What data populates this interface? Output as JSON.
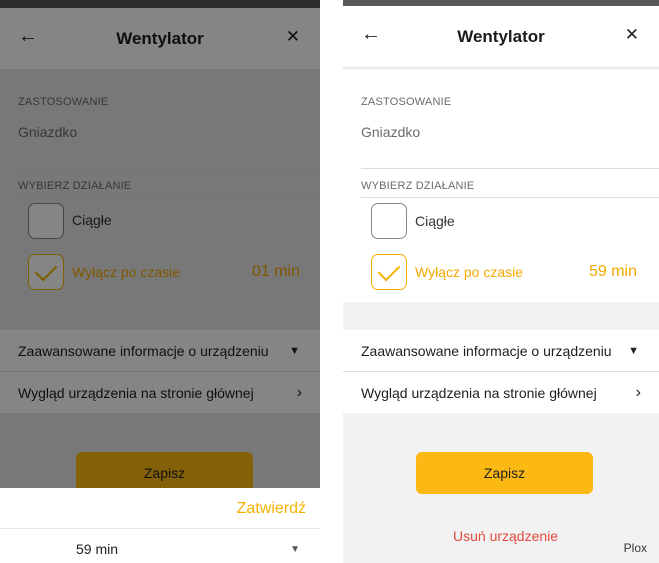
{
  "left_screen": {
    "title": "Wentylator",
    "back_icon": "arrow-left-icon",
    "close_icon": "close-icon",
    "usage_label": "ZASTOSOWANIE",
    "usage_value": "Gniazdko",
    "action_label": "WYBIERZ DZIAŁANIE",
    "options": [
      {
        "label": "Ciągłe",
        "checked": false
      },
      {
        "label": "Wyłącz po czasie",
        "checked": true
      }
    ],
    "timer_value": "01 min",
    "menu": [
      {
        "label": "Zaawansowane informacje o urządzeniu",
        "icon": "caret-down-icon"
      },
      {
        "label": "Wygląd urządzenia na stronie głównej",
        "icon": "chevron-right-icon"
      }
    ],
    "save_label": "Zapisz",
    "picker": {
      "confirm_label": "Zatwierdź",
      "selected_value": "59 min",
      "icon": "caret-down-icon"
    }
  },
  "right_screen": {
    "title": "Wentylator",
    "back_icon": "arrow-left-icon",
    "close_icon": "close-icon",
    "usage_label": "ZASTOSOWANIE",
    "usage_value": "Gniazdko",
    "action_label": "WYBIERZ DZIAŁANIE",
    "options": [
      {
        "label": "Ciągłe",
        "checked": false
      },
      {
        "label": "Wyłącz po czasie",
        "checked": true
      }
    ],
    "timer_value": "59 min",
    "menu": [
      {
        "label": "Zaawansowane informacje o urządzeniu",
        "icon": "caret-down-icon"
      },
      {
        "label": "Wygląd urządzenia na stronie głównej",
        "icon": "chevron-right-icon"
      }
    ],
    "save_label": "Zapisz",
    "delete_label": "Usuń urządzenie",
    "brand": "Plox"
  },
  "colors": {
    "accent": "#fdb913",
    "accent_text": "#f4a800",
    "danger": "#e44a3e",
    "overlay": "rgba(0,0,0,0.48)"
  }
}
